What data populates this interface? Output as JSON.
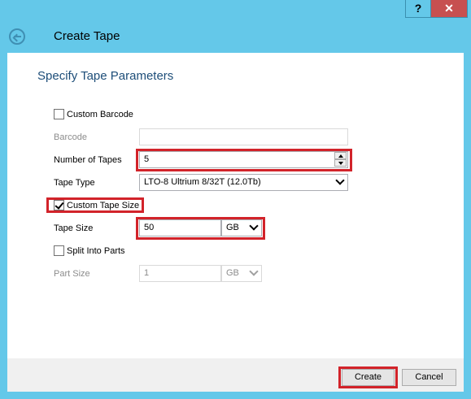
{
  "window": {
    "title": "Create Tape",
    "help_label": "?",
    "close_label": "✕"
  },
  "section_title": "Specify Tape Parameters",
  "form": {
    "custom_barcode_label": "Custom Barcode",
    "custom_barcode_checked": false,
    "barcode_label": "Barcode",
    "barcode_value": "",
    "number_of_tapes_label": "Number of Tapes",
    "number_of_tapes_value": "5",
    "tape_type_label": "Tape Type",
    "tape_type_value": "LTO-8 Ultrium 8/32T (12.0Tb)",
    "custom_tape_size_label": "Custom Tape Size",
    "custom_tape_size_checked": true,
    "tape_size_label": "Tape Size",
    "tape_size_value": "50",
    "tape_size_unit": "GB",
    "split_into_parts_label": "Split Into Parts",
    "split_into_parts_checked": false,
    "part_size_label": "Part Size",
    "part_size_value": "1",
    "part_size_unit": "GB"
  },
  "buttons": {
    "create_label": "Create",
    "cancel_label": "Cancel"
  },
  "colors": {
    "accent_frame": "#64c8e9",
    "highlight": "#d2232a",
    "section_title": "#1e4e79"
  }
}
